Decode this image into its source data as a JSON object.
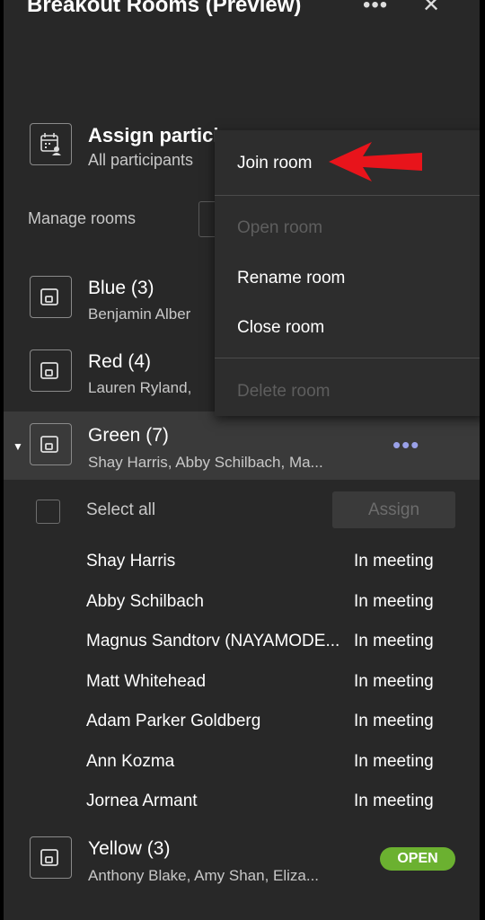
{
  "header": {
    "title": "Breakout Rooms (Preview)",
    "more_icon": "•••",
    "close_icon": "✕"
  },
  "assign": {
    "title": "Assign partici",
    "subtitle": "All participants"
  },
  "manage": {
    "label": "Manage rooms"
  },
  "rooms": {
    "blue": {
      "name": "Blue (3)",
      "members": "Benjamin Alber"
    },
    "red": {
      "name": "Red (4)",
      "members": "Lauren Ryland,"
    },
    "green": {
      "name": "Green (7)",
      "members": "Shay Harris, Abby Schilbach, Ma...",
      "more_icon": "•••",
      "select_all": "Select all",
      "assign_button": "Assign",
      "participants": [
        {
          "name": "Shay Harris",
          "status": "In meeting"
        },
        {
          "name": "Abby Schilbach",
          "status": "In meeting"
        },
        {
          "name": "Magnus Sandtorv (NAYAMODE...",
          "status": "In meeting"
        },
        {
          "name": "Matt Whitehead",
          "status": "In meeting"
        },
        {
          "name": "Adam Parker Goldberg",
          "status": "In meeting"
        },
        {
          "name": "Ann Kozma",
          "status": "In meeting"
        },
        {
          "name": "Jornea Armant",
          "status": "In meeting"
        }
      ]
    },
    "yellow": {
      "name": "Yellow (3)",
      "members": "Anthony Blake, Amy Shan, Eliza...",
      "badge": "OPEN"
    }
  },
  "menu": {
    "join_room": "Join room",
    "open_room": "Open room",
    "rename_room": "Rename room",
    "close_room": "Close room",
    "delete_room": "Delete room"
  },
  "colors": {
    "accent": "#9aa1e8",
    "open_badge": "#6bb130",
    "arrow": "#e8141b",
    "panel": "#282828"
  }
}
